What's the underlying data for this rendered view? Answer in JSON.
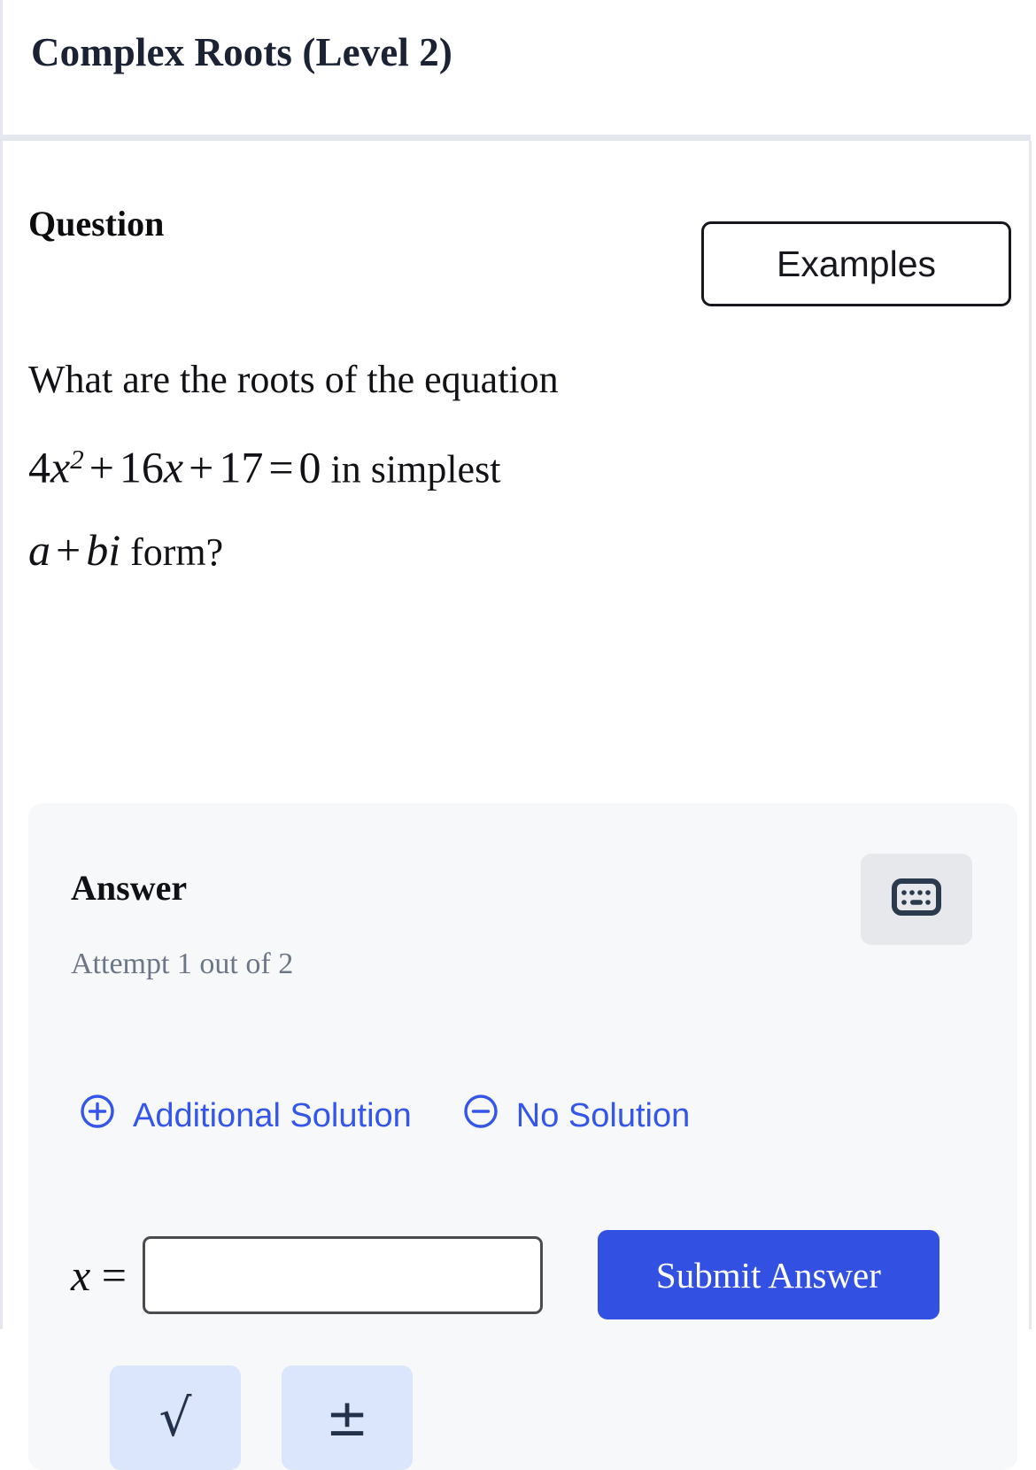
{
  "header": {
    "title": "Complex Roots (Level 2)"
  },
  "question_section": {
    "heading": "Question",
    "examples_label": "Examples",
    "text_lead": "What are the roots of the equation",
    "equation": {
      "coefficient_a": "4",
      "variable": "x",
      "exponent": "2",
      "plus_1": "+",
      "coefficient_b": "16",
      "variable_2": "x",
      "plus_2": "+",
      "constant_c": "17",
      "equals": "=",
      "rhs": "0",
      "plain": "4x^2 + 16x + 17 = 0"
    },
    "text_mid": "in simplest",
    "form": {
      "a": "a",
      "plus": "+",
      "b": "b",
      "i": "i",
      "word": "form?",
      "plain": "a + bi"
    }
  },
  "answer_section": {
    "heading": "Answer",
    "attempt_text": "Attempt 1 out of 2",
    "keyboard_icon": "keyboard-icon",
    "actions": [
      {
        "label": "Additional Solution",
        "icon": "plus-circle-icon"
      },
      {
        "label": "No Solution",
        "icon": "minus-circle-icon"
      }
    ],
    "input": {
      "prefix_variable": "x",
      "prefix_equals": "=",
      "value": "",
      "placeholder": ""
    },
    "submit_label": "Submit Answer",
    "keypad": [
      {
        "glyph": "√",
        "name": "sqrt-key"
      },
      {
        "glyph": "±",
        "name": "plus-minus-key"
      }
    ]
  },
  "colors": {
    "accent_blue": "#3556ea",
    "submit_blue": "#3251e2",
    "panel_bg": "#f6f8fa",
    "keypad_bg": "#dbe5fb",
    "muted_text": "#6c7686",
    "title_text": "#1a2234",
    "divider": "#e4e7ee"
  }
}
